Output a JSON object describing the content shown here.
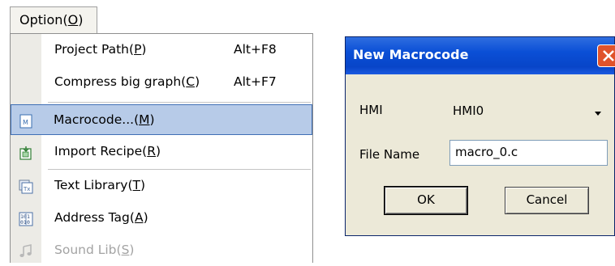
{
  "menu": {
    "title": "Option(O)",
    "items": [
      {
        "label": "Project Path(P)",
        "shortcut": "Alt+F8",
        "icon": "none"
      },
      {
        "label": "Compress big graph(C)",
        "shortcut": "Alt+F7",
        "icon": "none"
      },
      {
        "label": "Macrocode...(M)",
        "shortcut": "",
        "icon": "macro-document-icon",
        "selected": true
      },
      {
        "label": "Import Recipe(R)",
        "shortcut": "",
        "icon": "import-recipe-icon"
      },
      {
        "label": "Text Library(T)",
        "shortcut": "",
        "icon": "text-library-icon"
      },
      {
        "label": "Address Tag(A)",
        "shortcut": "",
        "icon": "address-tag-icon"
      },
      {
        "label": "Sound Lib(S)",
        "shortcut": "",
        "icon": "music-note-icon",
        "disabled": true
      }
    ]
  },
  "dialog": {
    "title": "New Macrocode",
    "hmi_label": "HMI",
    "hmi_value": "HMI0",
    "file_name_label": "File Name",
    "file_name_value": "macro_0.c",
    "ok_label": "OK",
    "cancel_label": "Cancel"
  },
  "colors": {
    "titlebar": "#0a4fd6",
    "selection": "#b7cbe8",
    "dialog_bg": "#ece9d8",
    "close_button": "#e0532b"
  }
}
